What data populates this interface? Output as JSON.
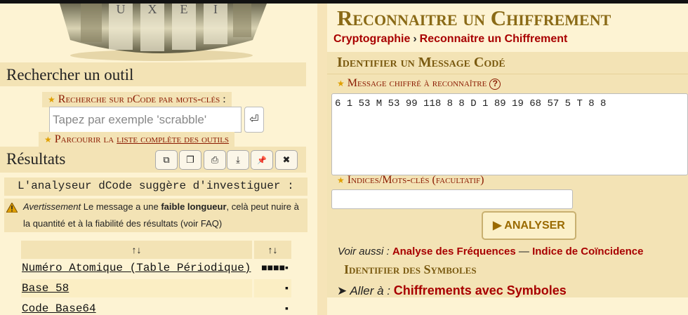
{
  "page": {
    "title": "Reconnaitre un Chiffrement",
    "breadcrumb": [
      "Cryptographie",
      "Reconnaitre un Chiffrement"
    ],
    "breadcrumb_sep": "›"
  },
  "sidebar": {
    "search_title": "Rechercher un outil",
    "keyword_search_label": "Recherche sur dCode par mots-clés",
    "keyword_search_colon": " :",
    "search_placeholder": "Tapez par exemple 'scrabble'",
    "enter_symbol": "⏎",
    "browse_prefix": "Parcourir la ",
    "browse_link": "liste complète des outils",
    "results_title": "Résultats",
    "toolbar_icons": [
      "copy-icon",
      "clipboard-icon",
      "print-icon",
      "download-icon",
      "pin-icon",
      "close-icon"
    ],
    "toolbar_glyphs": [
      "⧉",
      "❐",
      "⎙",
      "⤓",
      "📌",
      "✖"
    ],
    "suggestion": "L'analyseur dCode suggère d'investiguer :",
    "warning": {
      "label": "Avertissement",
      "text_before": " Le message a une ",
      "bold": "faible longueur",
      "text_after": ", celà peut nuire à la quantité et à la fiabilité des résultats (voir FAQ)"
    },
    "table": {
      "headers": [
        "↑↓",
        "↑↓"
      ],
      "rows": [
        {
          "name": "Numéro Atomique (Table Périodique)",
          "score": "■■■■▪"
        },
        {
          "name": "Base 58",
          "score": "▪"
        },
        {
          "name": "Code Base64",
          "score": "▪"
        }
      ]
    }
  },
  "main": {
    "section_title": "Identifier un Message Codé",
    "cipher_label": "Message chiffré à reconnaître",
    "help_symbol": "?",
    "cipher_text": "6 1 53 M 53 99 118 8 8 D 1 89 19 68 57 5 T 8 8",
    "hints_label": "Indices/Mots-clés (facultatif)",
    "hints_value": "",
    "analyse_label": "▶ ANALYSER",
    "see_also_label": "Voir aussi : ",
    "see_also_links": [
      "Analyse des Fréquences",
      "Indice de Coïncidence"
    ],
    "see_also_sep": " — ",
    "symbols_title": "Identifier des Symboles",
    "goto_arrow": "➤",
    "goto_label": " Aller à : ",
    "goto_link": "Chiffrements avec Symboles"
  },
  "colors": {
    "background": "#fdf3d3",
    "panel": "#f3e3b5",
    "title_gold": "#8a6a16",
    "link_red": "#a80000",
    "label_red": "#8a1a00"
  }
}
